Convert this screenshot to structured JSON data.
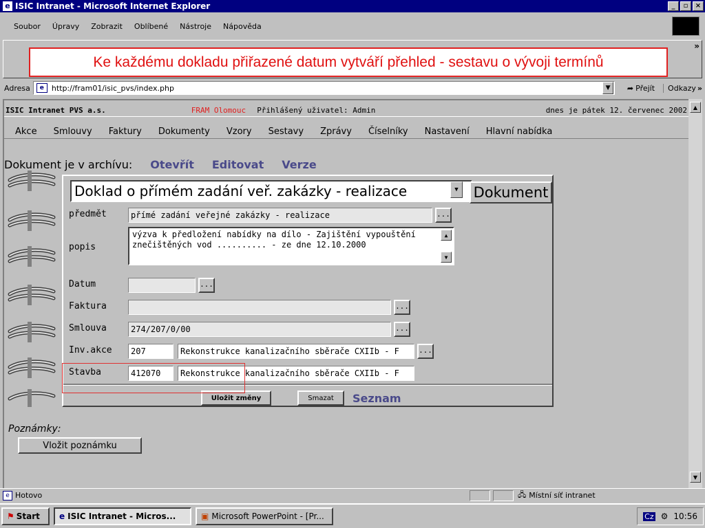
{
  "window": {
    "title": "ISIC Intranet - Microsoft Internet Explorer"
  },
  "menu": [
    "Soubor",
    "Úpravy",
    "Zobrazit",
    "Oblíbené",
    "Nástroje",
    "Nápověda"
  ],
  "callout": "Ke každému dokladu přiřazené datum vytváří přehled - sestavu o vývoji termínů",
  "address": {
    "label": "Adresa",
    "url": "http://fram01/isic_pvs/index.php",
    "go": "Přejít",
    "links": "Odkazy"
  },
  "infobar": {
    "company": "ISIC Intranet PVS a.s.",
    "location": "FRAM Olomouc",
    "user": "Přihlášený uživatel: Admin",
    "date": "dnes je pátek 12. červenec 2002"
  },
  "nav": [
    "Akce",
    "Smlouvy",
    "Faktury",
    "Dokumenty",
    "Vzory",
    "Sestavy",
    "Zprávy",
    "Číselníky",
    "Nastavení",
    "Hlavní nabídka"
  ],
  "doc": {
    "archive_text": "Dokument je v archívu:",
    "links": [
      "Otevřít",
      "Editovat",
      "Verze"
    ],
    "type": "Doklad o přímém zadání veř. zakázky - realizace",
    "type_button": "Dokument",
    "fields": {
      "predmet": {
        "label": "předmět",
        "value": "přímé zadání veřejné zakázky - realizace"
      },
      "popis": {
        "label": "popis",
        "value": "výzva k předložení nabídky na dílo - Zajištění vypouštění znečištěných vod .......... - ze dne 12.10.2000"
      },
      "datum": {
        "label": "Datum",
        "value": ""
      },
      "faktura": {
        "label": "Faktura",
        "value": ""
      },
      "smlouva": {
        "label": "Smlouva",
        "value": "274/207/0/00"
      },
      "invakce": {
        "label": "Inv.akce",
        "code": "207",
        "value": "Rekonstrukce kanalizačního sběrače CXIIb - F"
      },
      "stavba": {
        "label": "Stavba",
        "code": "412070",
        "value": "Rekonstrukce kanalizačního sběrače CXIIb - F"
      }
    },
    "dots": "...",
    "save": "Uložit změny",
    "delete": "Smazat",
    "list": "Seznam"
  },
  "notes": {
    "label": "Poznámky:",
    "button": "Vložit poznámku"
  },
  "status": {
    "text": "Hotovo",
    "zone": "Místní síť intranet"
  },
  "taskbar": {
    "start": "Start",
    "tasks": [
      "ISIC Intranet - Micros...",
      "Microsoft PowerPoint - [Pr..."
    ],
    "lang": "Cz",
    "time": "10:56"
  }
}
